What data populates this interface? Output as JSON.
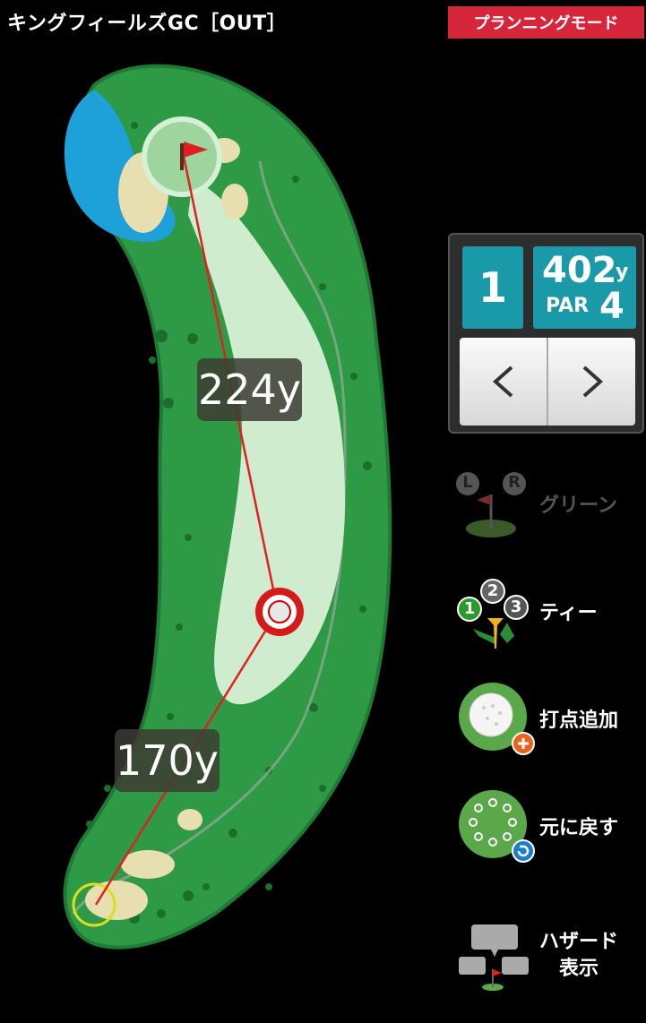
{
  "header": {
    "title": "キングフィールズGC［OUT］",
    "mode_badge": "プランニングモード"
  },
  "course": {
    "distance_to_pin": "224y",
    "distance_from_tee": "170y"
  },
  "hole_panel": {
    "hole_number": "1",
    "yardage": "402",
    "yard_unit": "y",
    "par_label": "PAR",
    "par_value": "4",
    "prev_label": "<",
    "next_label": ">"
  },
  "menu": {
    "green": {
      "label": "グリーン",
      "left_badge": "L",
      "right_badge": "R",
      "icon": "flag-on-green-icon"
    },
    "tee": {
      "label": "ティー",
      "badge1": "1",
      "badge2": "2",
      "badge3": "3",
      "icon": "golf-tee-icon"
    },
    "add_point": {
      "label": "打点追加",
      "icon": "golf-ball-add-icon"
    },
    "reset": {
      "label": "元に戻す",
      "icon": "undo-circle-icon"
    },
    "hazard_line1": "ハザード",
    "hazard_line2": "表示",
    "hazard_icon": "hazard-speech-bubbles-icon"
  },
  "colors": {
    "badge": "#d6263b",
    "panel_teal": "#1a9aa8",
    "rough": "#2f9a45",
    "fairway": "#cfeccf",
    "water": "#1da1d8",
    "bunker": "#e8dfb0",
    "shot_line": "#e02020"
  }
}
